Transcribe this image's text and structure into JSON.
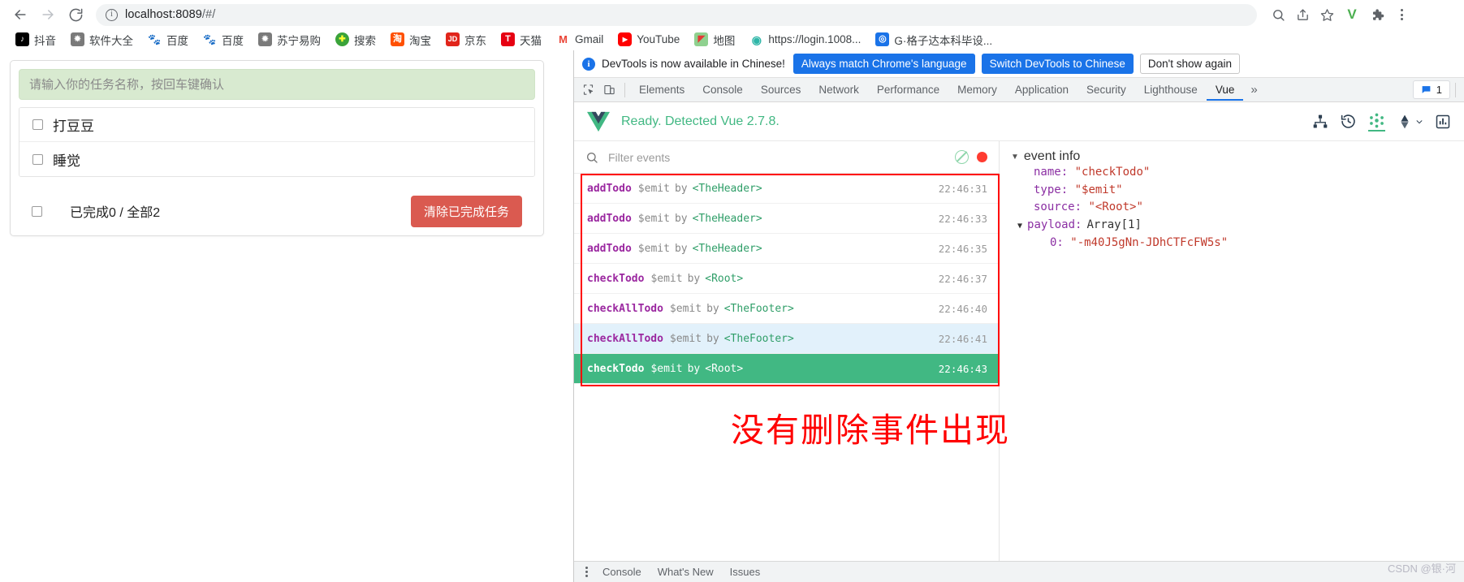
{
  "browser": {
    "nav": {
      "back": "back-arrow",
      "forward": "forward-arrow",
      "reload": "reload"
    },
    "omnibox": {
      "url_main": "localhost:8089",
      "url_path": "/#/",
      "info_glyph": "i"
    },
    "toolbar_right": {
      "search": "search-icon",
      "share": "share-icon",
      "star": "bookmark-star-icon",
      "profile_letter": "V",
      "extensions": "puzzle-icon",
      "menu": "three-dot-menu"
    },
    "bookmarks": [
      {
        "label": "抖音",
        "glyph": "♪",
        "bg": "#000000",
        "fg": "#ffffff"
      },
      {
        "label": "软件大全",
        "glyph": "◍",
        "bg": "#6d6d6d",
        "fg": "#ffffff"
      },
      {
        "label": "百度",
        "glyph": "熊",
        "bg": "#2932e1",
        "fg": "#ffffff"
      },
      {
        "label": "百度",
        "glyph": "熊",
        "bg": "#2932e1",
        "fg": "#ffffff"
      },
      {
        "label": "苏宁易购",
        "glyph": "◍",
        "bg": "#6d6d6d",
        "fg": "#ffffff"
      },
      {
        "label": "搜索",
        "glyph": "+",
        "bg": "#3aa33a",
        "fg": "#ffff00"
      },
      {
        "label": "淘宝",
        "glyph": "淘",
        "bg": "#ff5000",
        "fg": "#ffffff"
      },
      {
        "label": "京东",
        "glyph": "JD",
        "bg": "#e1251b",
        "fg": "#ffffff"
      },
      {
        "label": "天猫",
        "glyph": "T",
        "bg": "#e60012",
        "fg": "#ffffff"
      },
      {
        "label": "Gmail",
        "glyph": "M",
        "bg": "#ffffff",
        "fg": "#ea4335"
      },
      {
        "label": "YouTube",
        "glyph": "▶",
        "bg": "#ff0000",
        "fg": "#ffffff"
      },
      {
        "label": "地图",
        "glyph": "📍",
        "bg": "#8fd18f",
        "fg": "#ffffff"
      },
      {
        "label": "https://login.1008...",
        "glyph": "S",
        "bg": "#2fb6a8",
        "fg": "#ffffff"
      },
      {
        "label": "G·格子达本科毕设...",
        "glyph": "G",
        "bg": "#1a73e8",
        "fg": "#ffffff"
      }
    ]
  },
  "todo_app": {
    "input_placeholder": "请输入你的任务名称，按回车键确认",
    "input_value": "",
    "items": [
      {
        "label": "打豆豆",
        "checked": false
      },
      {
        "label": "睡觉",
        "checked": false
      }
    ],
    "footer": {
      "check_all_checked": false,
      "count_text": "已完成0 / 全部2",
      "clear_label": "清除已完成任务",
      "clear_color": "#da5a50"
    }
  },
  "devtools": {
    "notice": {
      "text": "DevTools is now available in Chinese!",
      "btn_always": "Always match Chrome's language",
      "btn_switch": "Switch DevTools to Chinese",
      "btn_dismiss": "Don't show again",
      "accent": "#1a73e8"
    },
    "tabs": [
      {
        "label": "Elements",
        "active": false
      },
      {
        "label": "Console",
        "active": false
      },
      {
        "label": "Sources",
        "active": false
      },
      {
        "label": "Network",
        "active": false
      },
      {
        "label": "Performance",
        "active": false
      },
      {
        "label": "Memory",
        "active": false
      },
      {
        "label": "Application",
        "active": false
      },
      {
        "label": "Security",
        "active": false
      },
      {
        "label": "Lighthouse",
        "active": false
      },
      {
        "label": "Vue",
        "active": true
      }
    ],
    "more_label": "»",
    "issues_count": "1",
    "bottom_drawer": {
      "tabs": [
        "Console",
        "What's New",
        "Issues"
      ]
    }
  },
  "vue_panel": {
    "status": "Ready. Detected Vue 2.7.8.",
    "status_color": "#42b883",
    "header_icons": [
      "component-tree-icon",
      "timeline-history-icon",
      "events-icon",
      "routing-icon",
      "performance-bars-icon"
    ],
    "events": {
      "filter_placeholder": "Filter events",
      "clear_icon": "no-entry-icon",
      "record_icon": "record-dot-icon",
      "rows": [
        {
          "name": "addTodo",
          "type": "$emit",
          "by": "by",
          "source": "<TheHeader>",
          "time": "22:46:31",
          "state": "normal"
        },
        {
          "name": "addTodo",
          "type": "$emit",
          "by": "by",
          "source": "<TheHeader>",
          "time": "22:46:33",
          "state": "normal"
        },
        {
          "name": "addTodo",
          "type": "$emit",
          "by": "by",
          "source": "<TheHeader>",
          "time": "22:46:35",
          "state": "normal"
        },
        {
          "name": "checkTodo",
          "type": "$emit",
          "by": "by",
          "source": "<Root>",
          "time": "22:46:37",
          "state": "normal"
        },
        {
          "name": "checkAllTodo",
          "type": "$emit",
          "by": "by",
          "source": "<TheFooter>",
          "time": "22:46:40",
          "state": "normal"
        },
        {
          "name": "checkAllTodo",
          "type": "$emit",
          "by": "by",
          "source": "<TheFooter>",
          "time": "22:46:41",
          "state": "hover"
        },
        {
          "name": "checkTodo",
          "type": "$emit",
          "by": "by",
          "source": "<Root>",
          "time": "22:46:43",
          "state": "selected"
        }
      ]
    },
    "event_info": {
      "title": "event info",
      "name_key": "name:",
      "name_value": "\"checkTodo\"",
      "type_key": "type:",
      "type_value": "\"$emit\"",
      "source_key": "source:",
      "source_value": "\"<Root>\"",
      "payload_key": "payload:",
      "payload_value": "Array[1]",
      "payload_index": "0:",
      "payload_item": "\"-m40J5gNn-JDhCTFcFW5s\""
    }
  },
  "annotation": {
    "text": "没有删除事件出现",
    "color": "#ff0000",
    "box_color": "#ff0000"
  },
  "watermark": "CSDN @银·河"
}
